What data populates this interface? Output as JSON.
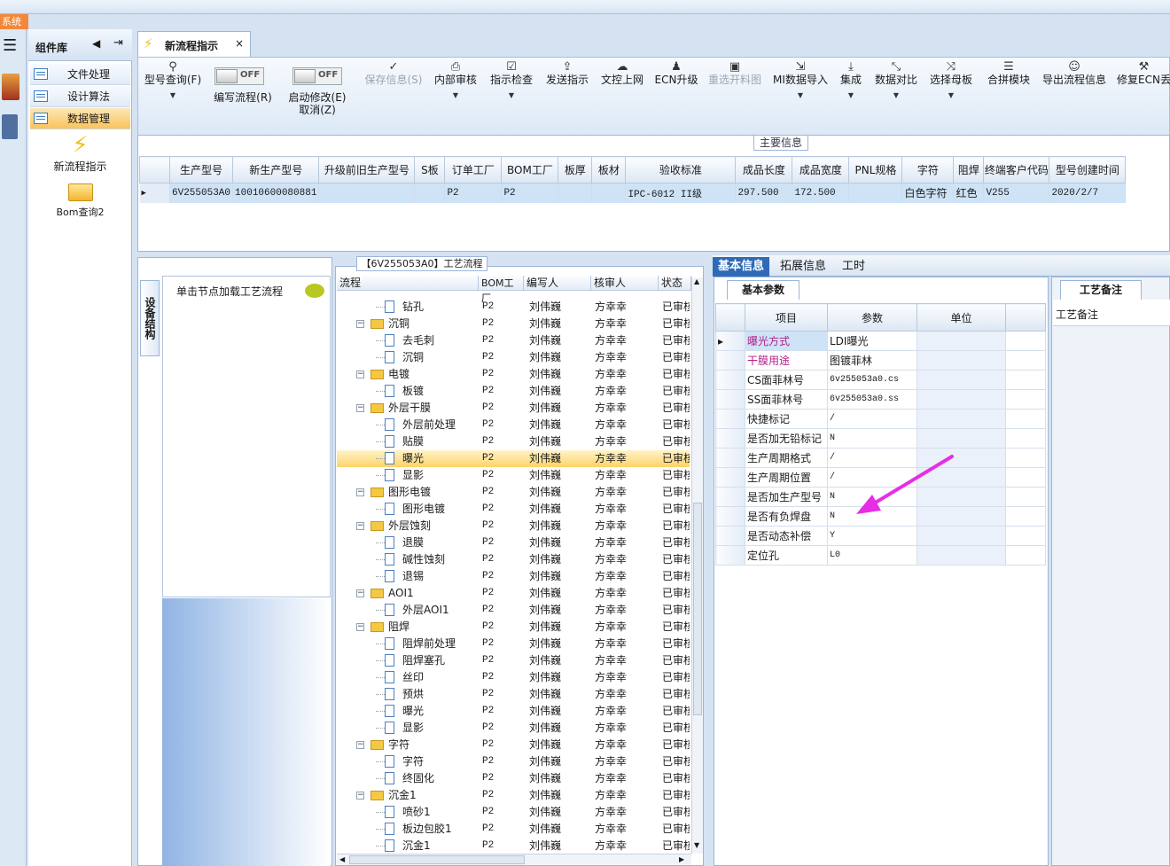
{
  "titlebar": {
    "app_tab": "系统"
  },
  "component_panel": {
    "title": "组件库",
    "items": [
      {
        "label": "文件处理"
      },
      {
        "label": "设计算法"
      },
      {
        "label": "数据管理"
      }
    ],
    "shortcuts": [
      {
        "label": "新流程指示",
        "icon": "lightning-icon"
      },
      {
        "label": "Bom查询2",
        "icon": "folder-open-icon"
      }
    ]
  },
  "document_tab": {
    "label": "新流程指示",
    "close": "×"
  },
  "toolbar": {
    "toggle_state": "OFF",
    "buttons": [
      {
        "label": "型号查询(F)",
        "icon": "search-icon"
      },
      {
        "label": "编写流程(R)"
      },
      {
        "label": "启动修改(E)"
      },
      {
        "label": "取消(Z)"
      },
      {
        "label": "保存信息(S)",
        "icon": "check-icon"
      },
      {
        "label": "内部审核",
        "icon": "printer-icon"
      },
      {
        "label": "指示检查",
        "icon": "checkbox-icon"
      },
      {
        "label": "发送指示",
        "icon": "upload-icon"
      },
      {
        "label": "文控上网",
        "icon": "cloud-upload-icon"
      },
      {
        "label": "ECN升级",
        "icon": "users-icon"
      },
      {
        "label": "重选开料图",
        "icon": "image-icon"
      },
      {
        "label": "MI数据导入",
        "icon": "import-icon"
      },
      {
        "label": "集成",
        "icon": "download-icon"
      },
      {
        "label": "数据对比",
        "icon": "compress-icon"
      },
      {
        "label": "选择母板",
        "icon": "shuffle-icon"
      },
      {
        "label": "合拼模块",
        "icon": "list-icon"
      },
      {
        "label": "导出流程信息",
        "icon": "smile-icon"
      },
      {
        "label": "修复ECN丢",
        "icon": "wrench-icon"
      }
    ]
  },
  "main_info": {
    "caption": "主要信息",
    "columns": [
      "生产型号",
      "新生产型号",
      "升级前旧生产型号",
      "S板",
      "订单工厂",
      "BOM工厂",
      "板厚",
      "板材",
      "验收标准",
      "成品长度",
      "成品宽度",
      "PNL规格",
      "字符",
      "阻焊",
      "终端客户代码",
      "型号创建时间"
    ],
    "row": [
      "6V255053A0",
      "10010600080881",
      "",
      "",
      "P2",
      "P2",
      "",
      "",
      "IPC-6012 II级",
      "297.500",
      "172.500",
      "",
      "白色字符",
      "红色",
      "V255",
      "2020/2/7"
    ]
  },
  "device_panel": {
    "tab": "设备结构",
    "hint": "单击节点加载工艺流程"
  },
  "process_tree": {
    "caption": "【6V255053A0】工艺流程",
    "columns": [
      "流程",
      "BOM工厂",
      "编写人",
      "核审人",
      "状态"
    ],
    "rows": [
      {
        "name": "钻孔",
        "level": 2,
        "type": "doc"
      },
      {
        "name": "沉铜",
        "level": 1,
        "type": "folder"
      },
      {
        "name": "去毛刺",
        "level": 2,
        "type": "doc"
      },
      {
        "name": "沉铜",
        "level": 2,
        "type": "doc"
      },
      {
        "name": "电镀",
        "level": 1,
        "type": "folder"
      },
      {
        "name": "板镀",
        "level": 2,
        "type": "doc"
      },
      {
        "name": "外层干膜",
        "level": 1,
        "type": "folder"
      },
      {
        "name": "外层前处理",
        "level": 2,
        "type": "doc"
      },
      {
        "name": "贴膜",
        "level": 2,
        "type": "doc"
      },
      {
        "name": "曝光",
        "level": 2,
        "type": "doc",
        "selected": true
      },
      {
        "name": "显影",
        "level": 2,
        "type": "doc"
      },
      {
        "name": "图形电镀",
        "level": 1,
        "type": "folder"
      },
      {
        "name": "图形电镀",
        "level": 2,
        "type": "doc"
      },
      {
        "name": "外层蚀刻",
        "level": 1,
        "type": "folder"
      },
      {
        "name": "退膜",
        "level": 2,
        "type": "doc"
      },
      {
        "name": "碱性蚀刻",
        "level": 2,
        "type": "doc"
      },
      {
        "name": "退锡",
        "level": 2,
        "type": "doc"
      },
      {
        "name": "AOI1",
        "level": 1,
        "type": "folder"
      },
      {
        "name": "外层AOI1",
        "level": 2,
        "type": "doc"
      },
      {
        "name": "阻焊",
        "level": 1,
        "type": "folder"
      },
      {
        "name": "阻焊前处理",
        "level": 2,
        "type": "doc"
      },
      {
        "name": "阻焊塞孔",
        "level": 2,
        "type": "doc"
      },
      {
        "name": "丝印",
        "level": 2,
        "type": "doc"
      },
      {
        "name": "预烘",
        "level": 2,
        "type": "doc"
      },
      {
        "name": "曝光",
        "level": 2,
        "type": "doc"
      },
      {
        "name": "显影",
        "level": 2,
        "type": "doc"
      },
      {
        "name": "字符",
        "level": 1,
        "type": "folder"
      },
      {
        "name": "字符",
        "level": 2,
        "type": "doc"
      },
      {
        "name": "终固化",
        "level": 2,
        "type": "doc"
      },
      {
        "name": "沉金1",
        "level": 1,
        "type": "folder"
      },
      {
        "name": "喷砂1",
        "level": 2,
        "type": "doc"
      },
      {
        "name": "板边包胶1",
        "level": 2,
        "type": "doc"
      },
      {
        "name": "沉金1",
        "level": 2,
        "type": "doc"
      }
    ],
    "bom": "P2",
    "author": "刘伟巍",
    "reviewer": "方幸幸",
    "status": "已审核"
  },
  "right_tabs": [
    "基本信息",
    "拓展信息",
    "工时"
  ],
  "basic_params": {
    "tab": "基本参数",
    "columns": [
      "项目",
      "参数",
      "单位"
    ],
    "rows": [
      {
        "item": "曝光方式",
        "value": "LDI曝光",
        "highlight": true
      },
      {
        "item": "干膜用途",
        "value": "图镀菲林",
        "highlight": true
      },
      {
        "item": "CS面菲林号",
        "value": "6v255053a0.cs"
      },
      {
        "item": "SS面菲林号",
        "value": "6v255053a0.ss"
      },
      {
        "item": "快捷标记",
        "value": "/"
      },
      {
        "item": "是否加无铅标记",
        "value": "N"
      },
      {
        "item": "生产周期格式",
        "value": "/"
      },
      {
        "item": "生产周期位置",
        "value": "/"
      },
      {
        "item": "是否加生产型号",
        "value": "N"
      },
      {
        "item": "是否有负焊盘",
        "value": "N"
      },
      {
        "item": "是否动态补偿",
        "value": "Y"
      },
      {
        "item": "定位孔",
        "value": "L0"
      }
    ]
  },
  "remark": {
    "tab": "工艺备注",
    "header": "工艺备注"
  },
  "colors": {
    "accent": "#2e6ab8",
    "selection": "#cfe3f7",
    "tree_selection": "#fcd46a",
    "annotation_arrow": "#e62ee6",
    "highlight_text": "#b0208a"
  }
}
